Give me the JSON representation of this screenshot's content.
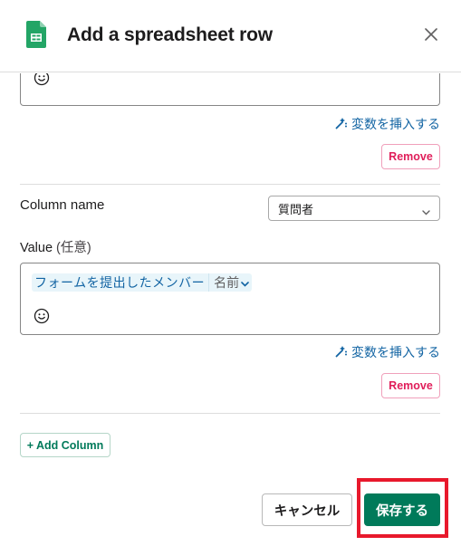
{
  "header": {
    "title": "Add a spreadsheet row",
    "icon": "google-sheets-icon",
    "close_icon": "close-icon"
  },
  "previous_column": {
    "emoji_icon": "emoji-icon",
    "insert_variable_label": "変数を挿入する",
    "remove_label": "Remove"
  },
  "column": {
    "name_label": "Column name",
    "selected_column": "質問者",
    "value_label": "Value",
    "value_optional": "(任意)",
    "variable_chip": {
      "source": "フォームを提出したメンバー",
      "field": "名前"
    },
    "insert_variable_label": "変数を挿入する",
    "remove_label": "Remove"
  },
  "add_column_label": "+ Add Column",
  "footer": {
    "cancel_label": "キャンセル",
    "save_label": "保存する"
  },
  "colors": {
    "primary": "#007a5a",
    "link": "#1264a3",
    "danger": "#e01e5a",
    "highlight": "#e8192c"
  }
}
